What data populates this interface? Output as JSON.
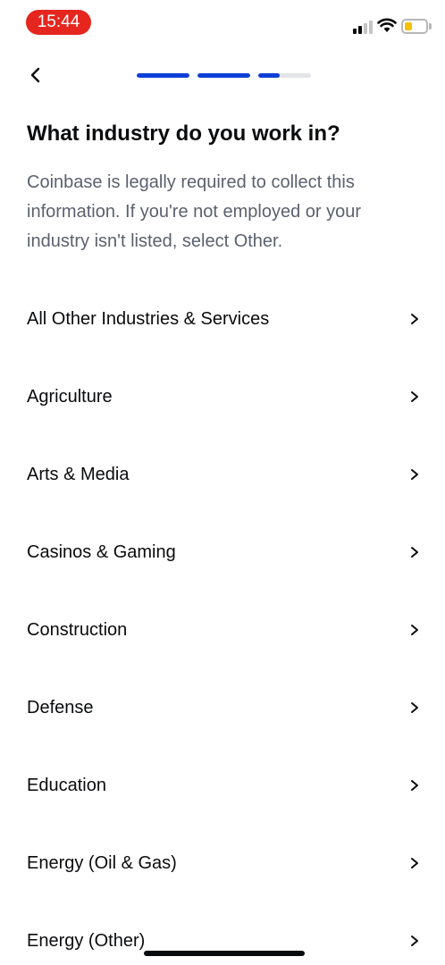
{
  "status_bar": {
    "time": "15:44",
    "time_pill_color": "#e5261f",
    "battery_color": "#f7c000"
  },
  "header": {
    "back_icon": "chevron-left-icon",
    "progress": [
      1.0,
      1.0,
      0.4
    ],
    "progress_color": "#0d3fd6"
  },
  "main": {
    "title": "What industry do you work in?",
    "description": "Coinbase is legally required to collect this information. If you're not employed or your industry isn't listed, select Other."
  },
  "industries": [
    {
      "label": "All Other Industries & Services"
    },
    {
      "label": "Agriculture"
    },
    {
      "label": "Arts & Media"
    },
    {
      "label": "Casinos & Gaming"
    },
    {
      "label": "Construction"
    },
    {
      "label": "Defense"
    },
    {
      "label": "Education"
    },
    {
      "label": "Energy (Oil & Gas)"
    },
    {
      "label": "Energy (Other)"
    }
  ]
}
